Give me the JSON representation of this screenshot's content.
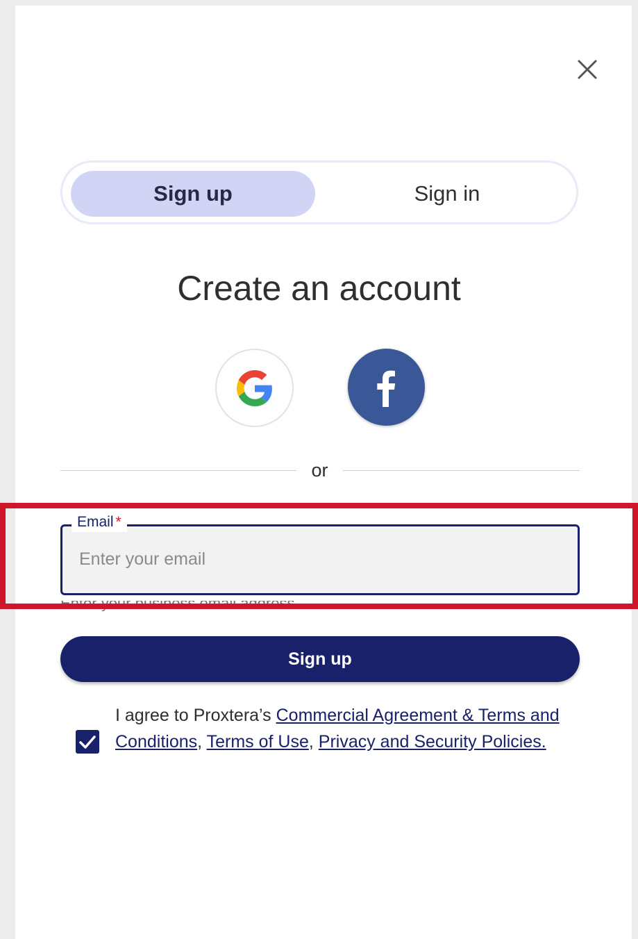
{
  "dialog": {
    "close_label": "Close"
  },
  "tabs": {
    "signup": "Sign up",
    "signin": "Sign in"
  },
  "title": "Create an account",
  "divider_text": "or",
  "email": {
    "label": "Email",
    "required_marker": "*",
    "placeholder": "Enter your email",
    "helper": "Enter your business email address"
  },
  "signup_button": "Sign up",
  "agreement": {
    "checked": true,
    "prefix": "I agree to Proxtera’s ",
    "link_commercial": "Commercial Agreement & Terms and Conditions",
    "sep1": ", ",
    "link_terms_of_use": "Terms of Use",
    "sep2": ", ",
    "link_privacy": "Privacy and Security Policies."
  },
  "colors": {
    "primary": "#19216b",
    "tab_active_bg": "#d1d4f4",
    "facebook": "#3a5897",
    "highlight": "#d0162a",
    "required": "#d0162a"
  }
}
